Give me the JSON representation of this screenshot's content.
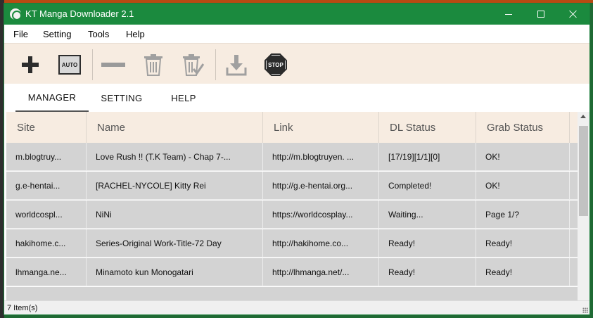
{
  "window": {
    "title": "KT Manga Downloader 2.1"
  },
  "menu": {
    "items": [
      "File",
      "Setting",
      "Tools",
      "Help"
    ]
  },
  "toolbar": {
    "auto_label": "AUTO",
    "stop_label": "STOP"
  },
  "tabs": [
    "MANAGER",
    "SETTING",
    "HELP"
  ],
  "active_tab": "MANAGER",
  "table": {
    "columns": [
      "Site",
      "Name",
      "Link",
      "DL Status",
      "Grab Status"
    ],
    "rows": [
      [
        "m.blogtruy...",
        "Love Rush !! (T.K Team) - Chap 7-...",
        "http://m.blogtruyen. ...",
        "[17/19][1/1][0]",
        "OK!"
      ],
      [
        "g.e-hentai...",
        "[RACHEL-NYCOLE] Kitty Rei",
        "http://g.e-hentai.org...",
        "Completed!",
        "OK!"
      ],
      [
        "worldcospl...",
        "NiNi",
        "https://worldcosplay...",
        "Waiting...",
        "Page 1/?"
      ],
      [
        "hakihome.c...",
        "Series-Original Work-Title-72 Day",
        "http://hakihome.co...",
        "Ready!",
        "Ready!"
      ],
      [
        "lhmanga.ne...",
        "Minamoto kun Monogatari",
        "http://lhmanga.net/...",
        "Ready!",
        "Ready!"
      ]
    ]
  },
  "status": {
    "text": "7 Item(s)"
  },
  "colors": {
    "titlebar": "#1b8a3e",
    "toolbar_bg": "#f7ece1",
    "row_bg": "#d3d3d3"
  }
}
